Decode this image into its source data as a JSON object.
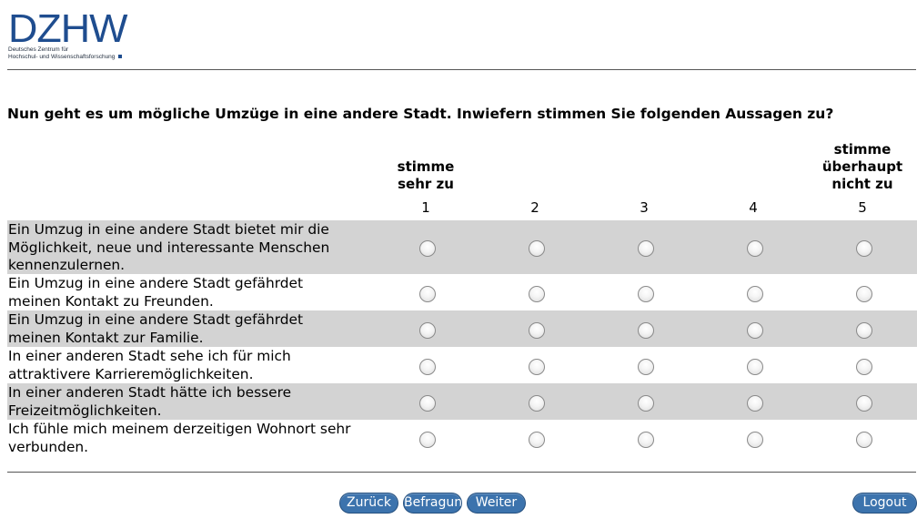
{
  "logo": {
    "word": "DZHW",
    "subline1": "Deutsches Zentrum für",
    "subline2": "Hochschul- und Wissenschaftsforschung"
  },
  "question": "Nun geht es um mögliche Umzüge in eine andere Stadt. Inwiefern stimmen Sie folgenden Aussagen zu?",
  "scale": {
    "low_label": [
      "stimme",
      "sehr zu"
    ],
    "high_label": [
      "stimme",
      "überhaupt",
      "nicht zu"
    ],
    "numbers": [
      "1",
      "2",
      "3",
      "4",
      "5"
    ]
  },
  "items": [
    [
      "Ein Umzug in eine andere Stadt bietet mir die",
      "Möglichkeit, neue und interessante Menschen",
      "kennenzulernen."
    ],
    [
      "Ein Umzug in eine andere Stadt gefährdet",
      "meinen Kontakt zu Freunden."
    ],
    [
      "Ein Umzug in eine andere Stadt gefährdet",
      "meinen Kontakt zur Familie."
    ],
    [
      "In einer anderen Stadt sehe ich für mich",
      "attraktivere Karrieremöglichkeiten."
    ],
    [
      "In einer anderen Stadt hätte ich bessere",
      "Freizeitmöglichkeiten."
    ],
    [
      "Ich fühle mich meinem derzeitigen Wohnort sehr",
      "verbunden."
    ]
  ],
  "buttons": {
    "back": "Zurück",
    "survey": "Befragun",
    "next": "Weiter",
    "logout": "Logout"
  }
}
